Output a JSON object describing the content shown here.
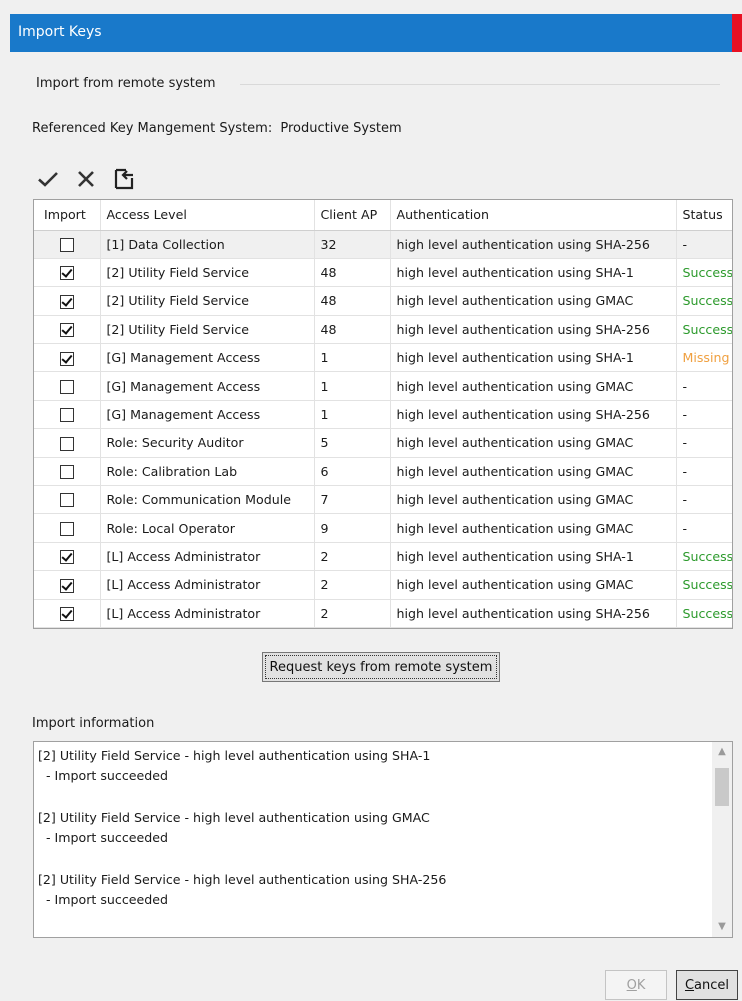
{
  "window": {
    "title": "Import Keys"
  },
  "group": {
    "label": "Import from remote system"
  },
  "reference": {
    "label": "Referenced Key Mangement System:",
    "value": "Productive System"
  },
  "toolbar": {
    "icons": [
      "checkmark-icon",
      "cross-icon",
      "import-icon"
    ]
  },
  "table": {
    "columns": [
      "Import",
      "Access Level",
      "Client AP",
      "Authentication",
      "Status"
    ],
    "rows": [
      {
        "checked": false,
        "level": "[1] Data Collection",
        "ap": "32",
        "auth": "high level authentication using SHA-256",
        "status": "-"
      },
      {
        "checked": true,
        "level": "[2] Utility Field Service",
        "ap": "48",
        "auth": "high level authentication using SHA-1",
        "status": "Success"
      },
      {
        "checked": true,
        "level": "[2] Utility Field Service",
        "ap": "48",
        "auth": "high level authentication using GMAC",
        "status": "Success"
      },
      {
        "checked": true,
        "level": "[2] Utility Field Service",
        "ap": "48",
        "auth": "high level authentication using SHA-256",
        "status": "Success"
      },
      {
        "checked": true,
        "level": "[G] Management Access",
        "ap": "1",
        "auth": "high level authentication using SHA-1",
        "status": "Missing"
      },
      {
        "checked": false,
        "level": "[G] Management Access",
        "ap": "1",
        "auth": "high level authentication using GMAC",
        "status": "-"
      },
      {
        "checked": false,
        "level": "[G] Management Access",
        "ap": "1",
        "auth": "high level authentication using SHA-256",
        "status": "-"
      },
      {
        "checked": false,
        "level": "Role: Security Auditor",
        "ap": "5",
        "auth": "high level authentication using GMAC",
        "status": "-"
      },
      {
        "checked": false,
        "level": "Role: Calibration Lab",
        "ap": "6",
        "auth": "high level authentication using GMAC",
        "status": "-"
      },
      {
        "checked": false,
        "level": "Role: Communication Module",
        "ap": "7",
        "auth": "high level authentication using GMAC",
        "status": "-"
      },
      {
        "checked": false,
        "level": "Role: Local Operator",
        "ap": "9",
        "auth": "high level authentication using GMAC",
        "status": "-"
      },
      {
        "checked": true,
        "level": "[L] Access Administrator",
        "ap": "2",
        "auth": "high level authentication using SHA-1",
        "status": "Success"
      },
      {
        "checked": true,
        "level": "[L] Access Administrator",
        "ap": "2",
        "auth": "high level authentication using GMAC",
        "status": "Success"
      },
      {
        "checked": true,
        "level": "[L] Access Administrator",
        "ap": "2",
        "auth": "high level authentication using SHA-256",
        "status": "Success"
      }
    ]
  },
  "request_button": "Request keys from remote system",
  "info": {
    "label": "Import information",
    "entries": [
      {
        "title": "[2] Utility Field Service - high level authentication using SHA-1",
        "detail": "- Import succeeded"
      },
      {
        "title": "[2] Utility Field Service - high level authentication using GMAC",
        "detail": "- Import succeeded"
      },
      {
        "title": "[2] Utility Field Service - high level authentication using SHA-256",
        "detail": "- Import succeeded"
      }
    ]
  },
  "buttons": {
    "ok": {
      "mnemonic": "O",
      "rest": "K"
    },
    "cancel": {
      "mnemonic": "C",
      "rest": "ancel"
    }
  },
  "colors": {
    "titlebar": "#1979ca",
    "success": "#2c9a2c",
    "missing": "#f0a040",
    "close": "#e81123"
  }
}
